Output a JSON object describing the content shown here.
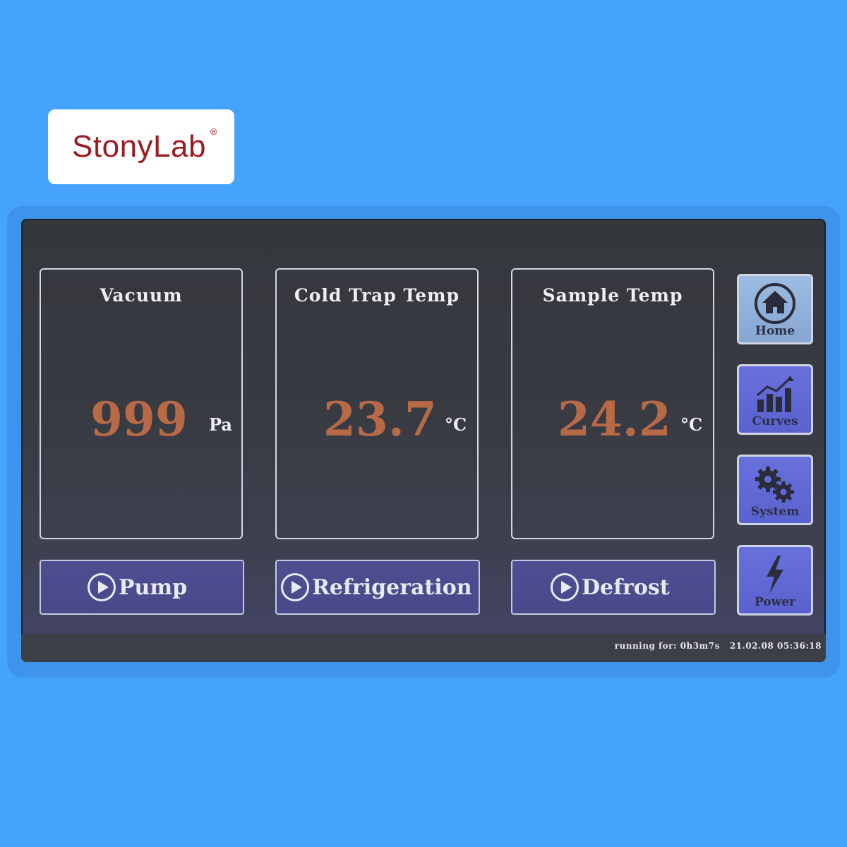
{
  "brand": {
    "name": "StonyLab",
    "registered_mark": "®"
  },
  "panels": [
    {
      "title": "Vacuum",
      "value": "999",
      "unit": "Pa"
    },
    {
      "title": "Cold Trap Temp",
      "value": "23.7",
      "unit": "°C"
    },
    {
      "title": "Sample Temp",
      "value": "24.2",
      "unit": "°C"
    }
  ],
  "actions": [
    {
      "label": "Pump",
      "icon": "play-circle-icon"
    },
    {
      "label": "Refrigeration",
      "icon": "play-circle-icon"
    },
    {
      "label": "Defrost",
      "icon": "play-circle-icon"
    }
  ],
  "nav": [
    {
      "label": "Home",
      "icon": "home-icon"
    },
    {
      "label": "Curves",
      "icon": "chart-icon"
    },
    {
      "label": "System",
      "icon": "gears-icon"
    },
    {
      "label": "Power",
      "icon": "lightning-icon"
    }
  ],
  "status": {
    "running_label": "running for:",
    "running_value": "0h3m7s",
    "datetime": "21.02.08 05:36:18"
  },
  "colors": {
    "background": "#46a3fb",
    "value_color": "#b86a47",
    "brand_color": "#9b1c22",
    "home_button": "#8fb0d9",
    "nav_button": "#5e67d6"
  }
}
